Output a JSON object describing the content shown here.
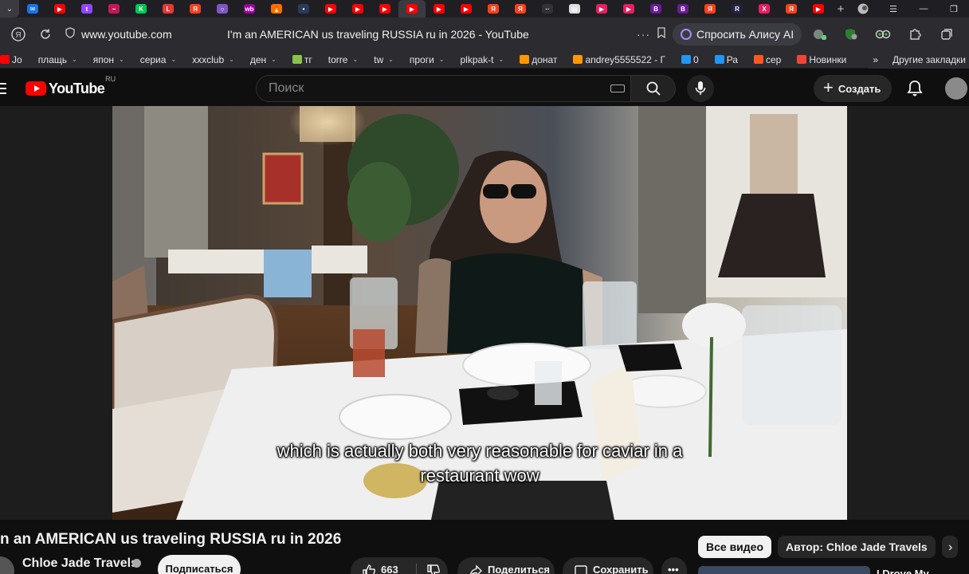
{
  "browser": {
    "tabs": [
      {
        "icon": "mail-icon",
        "color": "#1a73e8",
        "glyph": "✉"
      },
      {
        "icon": "youtube-icon",
        "color": "#ff0000",
        "glyph": "▶"
      },
      {
        "icon": "twitch-icon",
        "color": "#9146ff",
        "glyph": "t"
      },
      {
        "icon": "media-icon",
        "color": "#c2185b",
        "glyph": "~"
      },
      {
        "icon": "kinopoisk-icon",
        "color": "#00c853",
        "glyph": "K"
      },
      {
        "icon": "live-icon",
        "color": "#e53935",
        "glyph": "L"
      },
      {
        "icon": "yandex-icon",
        "color": "#fc3f1d",
        "glyph": "Я"
      },
      {
        "icon": "ring-icon",
        "color": "#7e57c2",
        "glyph": "○"
      },
      {
        "icon": "wildberries-icon",
        "color": "#a000a0",
        "glyph": "wb"
      },
      {
        "icon": "fire-icon",
        "color": "#ff6d00",
        "glyph": "🔥"
      },
      {
        "icon": "dark-site-icon",
        "color": "#2a3a5a",
        "glyph": "•"
      },
      {
        "icon": "youtube-icon",
        "color": "#ff0000",
        "glyph": "▶"
      },
      {
        "icon": "youtube-icon",
        "color": "#ff0000",
        "glyph": "▶"
      },
      {
        "icon": "youtube-icon",
        "color": "#ff0000",
        "glyph": "▶"
      },
      {
        "icon": "youtube-icon",
        "color": "#ff0000",
        "glyph": "▶",
        "active": true
      },
      {
        "icon": "youtube-icon",
        "color": "#ff0000",
        "glyph": "▶"
      },
      {
        "icon": "youtube-icon",
        "color": "#ff0000",
        "glyph": "▶"
      },
      {
        "icon": "yandex-icon",
        "color": "#fc3f1d",
        "glyph": "Я"
      },
      {
        "icon": "yandex-icon",
        "color": "#fc3f1d",
        "glyph": "Я"
      },
      {
        "icon": "dots-icon",
        "color": "#333333",
        "glyph": "··"
      },
      {
        "icon": "document-icon",
        "color": "#dddddd",
        "glyph": "▤"
      },
      {
        "icon": "play-circle-icon",
        "color": "#e91e63",
        "glyph": "▶"
      },
      {
        "icon": "play-circle-icon",
        "color": "#e91e63",
        "glyph": "▶"
      },
      {
        "icon": "b-icon",
        "color": "#6a1b9a",
        "glyph": "B"
      },
      {
        "icon": "b-icon",
        "color": "#6a1b9a",
        "glyph": "B"
      },
      {
        "icon": "yandex-icon",
        "color": "#fc3f1d",
        "glyph": "Я"
      },
      {
        "icon": "r-icon",
        "color": "#222244",
        "glyph": "R"
      },
      {
        "icon": "x-icon",
        "color": "#e91e63",
        "glyph": "X"
      },
      {
        "icon": "yandex-icon",
        "color": "#fc3f1d",
        "glyph": "Я"
      },
      {
        "icon": "youtube-icon",
        "color": "#ff0000",
        "glyph": "▶"
      }
    ],
    "address": {
      "domain": "www.youtube.com",
      "title": "I'm an AMERICAN us traveling RUSSIA ru in 2026 - YouTube",
      "more": "···",
      "alice_label": "Спросить Алису AI"
    },
    "bookmarks": [
      {
        "label": "Jo",
        "color": "#ff0000",
        "caret": false
      },
      {
        "label": "плащь",
        "caret": true
      },
      {
        "label": "япон",
        "caret": true
      },
      {
        "label": "сериа",
        "caret": true
      },
      {
        "label": "xxxclub",
        "caret": true
      },
      {
        "label": "ден",
        "caret": true
      },
      {
        "label": "тг",
        "color": "#8bc34a",
        "caret": false
      },
      {
        "label": "torre",
        "caret": true
      },
      {
        "label": "tw",
        "caret": true
      },
      {
        "label": "проги",
        "caret": true
      },
      {
        "label": "plkpak-t",
        "caret": true
      },
      {
        "label": "донат",
        "color": "#ff9800",
        "caret": false
      },
      {
        "label": "andrey5555522 - Г",
        "color": "#ff9800",
        "caret": false
      },
      {
        "label": "0",
        "color": "#2196f3",
        "caret": false
      },
      {
        "label": "Ра",
        "color": "#2196f3",
        "caret": false
      },
      {
        "label": "сер",
        "color": "#ff5722",
        "caret": false
      },
      {
        "label": "Новинки",
        "color": "#f44336",
        "caret": false
      }
    ],
    "bookmarks_more": "»",
    "other_bookmarks": "Другие закладки"
  },
  "youtube": {
    "logo_text": "YouTube",
    "country": "RU",
    "search_placeholder": "Поиск",
    "create_label": "Создать",
    "subtitle_line1": "which is actually both very reasonable for caviar in a",
    "subtitle_line2": "restaurant wow",
    "video_title": "n an AMERICAN us traveling RUSSIA ru in 2026",
    "channel_name": "Chloe Jade Travels",
    "subscribe_label": "Подписаться",
    "like_count": "663",
    "share_label": "Поделиться",
    "save_label": "Сохранить",
    "chips": [
      {
        "label": "Все видео",
        "active": true
      },
      {
        "label": "Автор: Chloe Jade Travels",
        "active": false
      },
      {
        "label": "",
        "active": false
      }
    ],
    "rec_title": "I Drove My"
  },
  "colors": {
    "youtube_red": "#ff0000",
    "alice_accent": "#a78bfa"
  }
}
